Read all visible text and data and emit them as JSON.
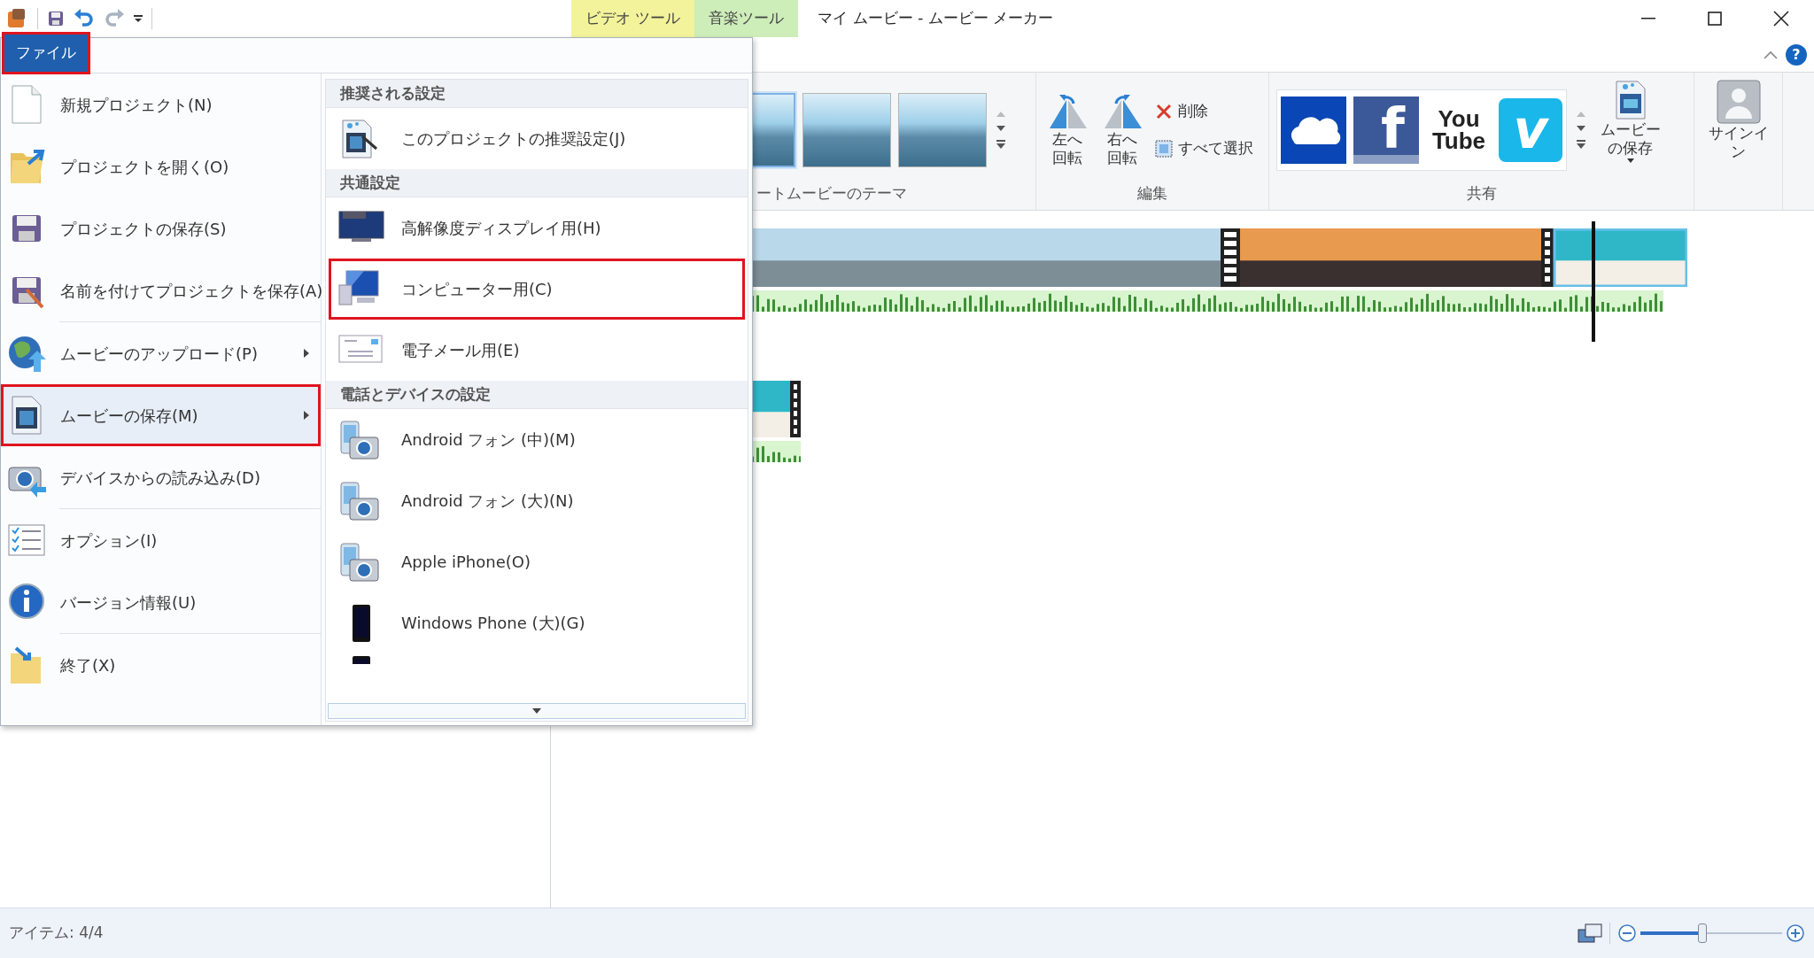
{
  "title_bar": {
    "title": "マイ ムービー - ムービー メーカー",
    "context_tabs": [
      {
        "label": "ビデオ ツール",
        "color": "#f3f39b"
      },
      {
        "label": "音楽ツール",
        "color": "#cdedb9"
      }
    ],
    "help_label": "?"
  },
  "file_tab": {
    "label": "ファイル",
    "highlighted": true
  },
  "ribbon": {
    "themes_group": {
      "label": "ートムービーのテーマ",
      "thumbnails": [
        {
          "selected": true
        },
        {
          "selected": false
        },
        {
          "selected": false
        }
      ]
    },
    "edit_group": {
      "label": "編集",
      "large_buttons": [
        {
          "kind": "rotate-left",
          "label": "左へ回転"
        },
        {
          "kind": "rotate-right",
          "label": "右へ回転"
        }
      ],
      "small_buttons": [
        {
          "kind": "delete",
          "label": "削除"
        },
        {
          "kind": "select-all",
          "label": "すべて選択"
        }
      ]
    },
    "share_group": {
      "label": "共有",
      "services": [
        {
          "kind": "onedrive"
        },
        {
          "kind": "facebook",
          "logo_text": "f"
        },
        {
          "kind": "youtube",
          "logo_text": "You\nTube"
        },
        {
          "kind": "vimeo",
          "logo_text": "v"
        }
      ],
      "save_movie_label": "ムービーの保存"
    },
    "sign_in_label": "サインイン"
  },
  "file_menu": {
    "groups": [
      [
        {
          "kind": "new",
          "label": "新規プロジェクト(N)",
          "submenu": false,
          "selected": false,
          "highlighted": false
        },
        {
          "kind": "open",
          "label": "プロジェクトを開く(O)",
          "submenu": false,
          "selected": false,
          "highlighted": false
        },
        {
          "kind": "save",
          "label": "プロジェクトの保存(S)",
          "submenu": false,
          "selected": false,
          "highlighted": false
        },
        {
          "kind": "save-as",
          "label": "名前を付けてプロジェクトを保存(A)",
          "submenu": false,
          "selected": false,
          "highlighted": false
        }
      ],
      [
        {
          "kind": "upload",
          "label": "ムービーのアップロード(P)",
          "submenu": true,
          "selected": false,
          "highlighted": false
        },
        {
          "kind": "movie",
          "label": "ムービーの保存(M)",
          "submenu": true,
          "selected": true,
          "highlighted": true
        },
        {
          "kind": "device",
          "label": "デバイスからの読み込み(D)",
          "submenu": false,
          "selected": false,
          "highlighted": false
        }
      ],
      [
        {
          "kind": "options",
          "label": "オプション(I)",
          "submenu": false,
          "selected": false,
          "highlighted": false
        },
        {
          "kind": "about",
          "label": "バージョン情報(U)",
          "submenu": false,
          "selected": false,
          "highlighted": false
        }
      ],
      [
        {
          "kind": "exit",
          "label": "終了(X)",
          "submenu": false,
          "selected": false,
          "highlighted": false
        }
      ]
    ],
    "submenu": [
      {
        "header": "推奨される設定",
        "items": [
          {
            "kind": "project",
            "label": "このプロジェクトの推奨設定(J)",
            "highlighted": false
          }
        ]
      },
      {
        "header": "共通設定",
        "items": [
          {
            "kind": "hd-display",
            "label": "高解像度ディスプレイ用(H)",
            "highlighted": false
          },
          {
            "kind": "computer",
            "label": "コンピューター用(C)",
            "highlighted": true
          },
          {
            "kind": "email",
            "label": "電子メール用(E)",
            "highlighted": false
          }
        ]
      },
      {
        "header": "電話とデバイスの設定",
        "items": [
          {
            "kind": "phone-camera",
            "label": "Android フォン (中)(M)",
            "highlighted": false
          },
          {
            "kind": "phone-camera",
            "label": "Android フォン (大)(N)",
            "highlighted": false
          },
          {
            "kind": "phone-camera",
            "label": "Apple iPhone(O)",
            "highlighted": false
          },
          {
            "kind": "black-phone",
            "label": "Windows Phone (大)(G)",
            "highlighted": false
          },
          {
            "kind": "black-phone",
            "clipped": true
          }
        ]
      }
    ]
  },
  "status_bar": {
    "items_text": "アイテム: 4/4",
    "zoom": {
      "level": 0.44
    }
  }
}
